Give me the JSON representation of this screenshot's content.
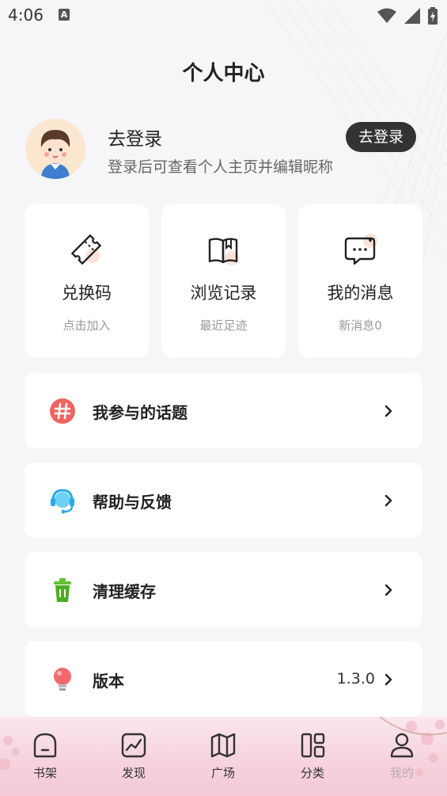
{
  "status_bar": {
    "time": "4:06"
  },
  "page": {
    "title": "个人中心"
  },
  "profile": {
    "title": "去登录",
    "subtitle": "登录后可查看个人主页并编辑昵称",
    "login_button": "去登录"
  },
  "quick_actions": [
    {
      "label": "兑换码",
      "sub": "点击加入",
      "icon": "ticket-icon"
    },
    {
      "label": "浏览记录",
      "sub": "最近足迹",
      "icon": "book-icon"
    },
    {
      "label": "我的消息",
      "sub": "新消息0",
      "icon": "message-icon"
    }
  ],
  "menu": [
    {
      "label": "我参与的话题",
      "icon": "hashtag-icon",
      "value": ""
    },
    {
      "label": "帮助与反馈",
      "icon": "headset-icon",
      "value": ""
    },
    {
      "label": "清理缓存",
      "icon": "trash-icon",
      "value": ""
    },
    {
      "label": "版本",
      "icon": "lightbulb-icon",
      "value": "1.3.0"
    }
  ],
  "bottom_nav": [
    {
      "label": "书架",
      "icon": "bookshelf-icon"
    },
    {
      "label": "发现",
      "icon": "trend-icon"
    },
    {
      "label": "广场",
      "icon": "map-icon"
    },
    {
      "label": "分类",
      "icon": "category-icon"
    },
    {
      "label": "我的",
      "icon": "person-icon",
      "active": true
    }
  ],
  "colors": {
    "background": "#f6f6f8",
    "login_button": "#333333",
    "hashtag": "#f0645f",
    "headset": "#2aa8e8",
    "trash": "#63c234",
    "bulb": "#f06a6a",
    "nav_active": "#b9a9b0"
  }
}
